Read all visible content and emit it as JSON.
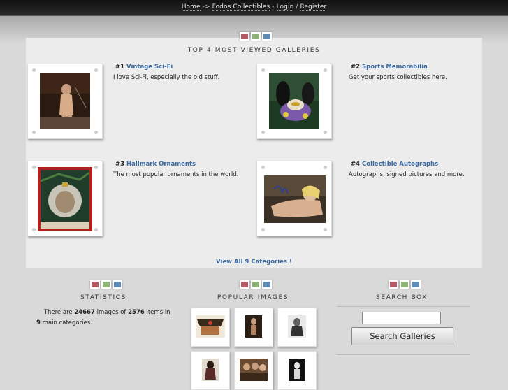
{
  "breadcrumb": {
    "home": "Home",
    "arrow": "->",
    "site": "Fodos Collectibles",
    "dash": "-",
    "login": "Login",
    "slash": "/",
    "register": "Register"
  },
  "top_galleries": {
    "title": "TOP 4 MOST VIEWED GALLERIES",
    "items": [
      {
        "rank": "#1",
        "name": "Vintage Sci-Fi",
        "description": "I love Sci-Fi, especially the old stuff."
      },
      {
        "rank": "#2",
        "name": "Sports Memorabilia",
        "description": "Get your sports collectibles here."
      },
      {
        "rank": "#3",
        "name": "Hallmark Ornaments",
        "description": "The most popular ornaments in the world."
      },
      {
        "rank": "#4",
        "name": "Collectible Autographs",
        "description": "Autographs, signed pictures and more."
      }
    ],
    "view_all": "View All 9 Categories !"
  },
  "statistics": {
    "title": "STATISTICS",
    "prefix": "There are",
    "images": "24667",
    "images_label": "images of",
    "items": "2576",
    "items_label": "items in",
    "categories": "9",
    "categories_label": "main categories."
  },
  "popular_images": {
    "title": "POPULAR IMAGES"
  },
  "search_box": {
    "title": "SEARCH BOX",
    "input_value": "",
    "button_label": "Search Galleries"
  },
  "colors": {
    "accent_link": "#3b6aa0",
    "topbar": "#1a1a1a",
    "panel": "#ececec",
    "dot_red": "#b55a64",
    "dot_green": "#8fb478",
    "dot_blue": "#5e8cb6"
  }
}
